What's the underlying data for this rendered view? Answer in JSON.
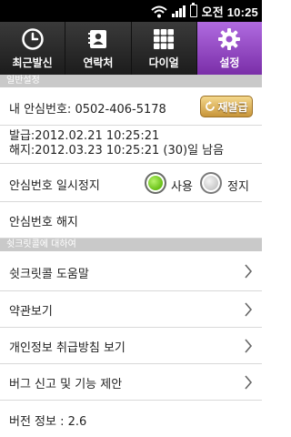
{
  "status_bar": {
    "time": "오전 10:25",
    "icons": [
      "wifi-icon",
      "signal-icon",
      "battery-icon"
    ]
  },
  "tabs": [
    {
      "label": "최근발신",
      "icon": "clock-icon",
      "active": false
    },
    {
      "label": "연락처",
      "icon": "contacts-icon",
      "active": false
    },
    {
      "label": "다이얼",
      "icon": "dialpad-icon",
      "active": false
    },
    {
      "label": "설정",
      "icon": "gear-icon",
      "active": true
    }
  ],
  "general": {
    "header": "일반설정",
    "safe_number_label": "내 안심번호: 0502-406-5178",
    "renew_button": "재발급",
    "issued": "발급:2012.02.21 10:25:21",
    "expires": "해지:2012.03.23 10:25:21 (30)일 남음",
    "pause_label": "안심번호 일시정지",
    "radio_use": "사용",
    "radio_stop": "정지",
    "selected": "사용",
    "cancel_label": "안심번호 해지"
  },
  "about": {
    "header": "쉿크릿콜에 대하여",
    "items": [
      "쉿크릿콜 도움말",
      "약관보기",
      "개인정보 취급방침 보기",
      "버그 신고 및 기능 제안"
    ],
    "version": "버전 정보 : 2.6"
  },
  "colors": {
    "accent": "#8e3fbf",
    "header_bg": "#c9c9c9",
    "radio_selected": "#6cc21a",
    "renew_button": "#d9a94c"
  }
}
